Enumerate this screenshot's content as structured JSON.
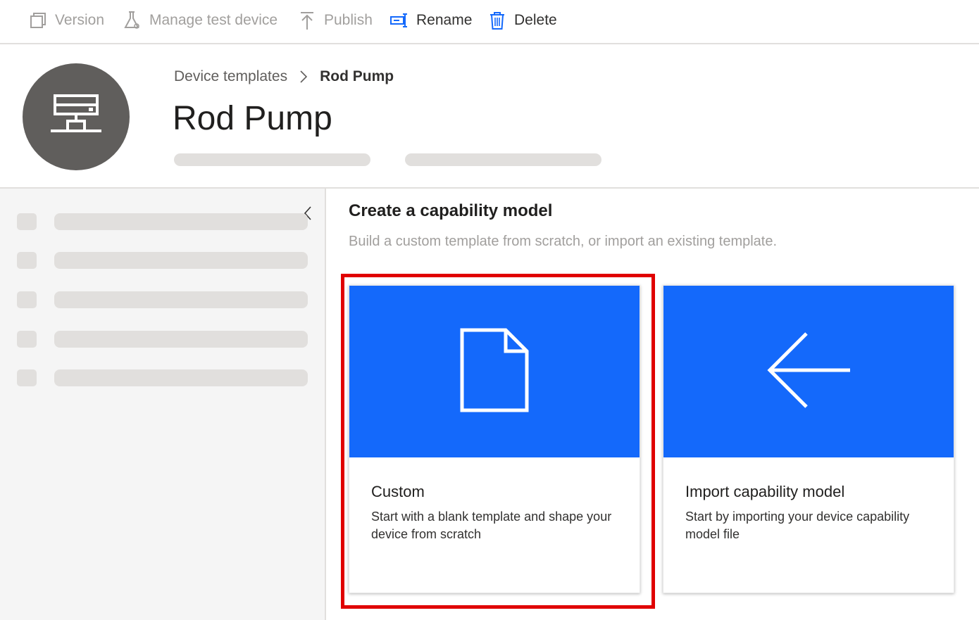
{
  "toolbar": {
    "version_label": "Version",
    "manage_test_device_label": "Manage test device",
    "publish_label": "Publish",
    "rename_label": "Rename",
    "delete_label": "Delete"
  },
  "header": {
    "avatar_icon": "device-network-icon",
    "breadcrumb": {
      "parent": "Device templates",
      "current": "Rod Pump"
    },
    "title": "Rod Pump"
  },
  "main": {
    "title": "Create a capability model",
    "subtitle": "Build a custom template from scratch, or import an existing template.",
    "cards": [
      {
        "icon": "blank-document-icon",
        "title": "Custom",
        "description": "Start with a blank template and shape your device from scratch",
        "selected": true
      },
      {
        "icon": "arrow-left-icon",
        "title": "Import capability model",
        "description": "Start by importing your device capability model file",
        "selected": false
      }
    ]
  },
  "colors": {
    "accent": "#1469fb",
    "highlight": "#e00000",
    "skeleton": "#e1dfdd",
    "avatar": "#605e5c"
  }
}
